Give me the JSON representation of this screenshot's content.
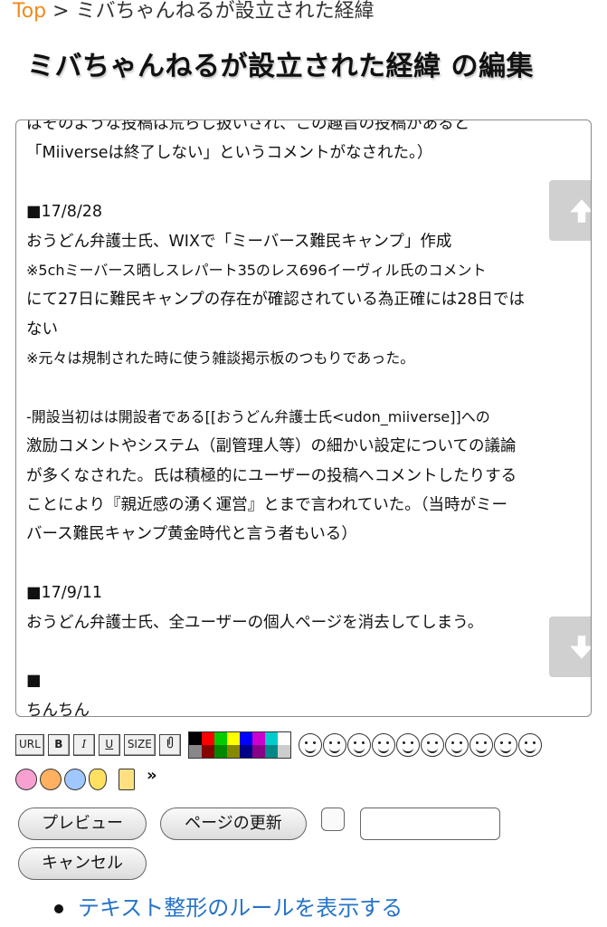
{
  "breadcrumb": {
    "top_label": "Top",
    "separator": ">",
    "current": "ミバちゃんねるが設立された経緯"
  },
  "page_title": "ミバちゃんねるが設立された経緯 の編集",
  "editor": {
    "lines": [
      "はそのような投稿は荒らし扱いされ、この趣旨の投稿があると",
      "「Miiverseは終了しない」というコメントがなされた。）",
      "",
      "■17/8/28",
      "おうどん弁護士氏、WIXで「ミーバース難民キャンプ」作成",
      "※5chミーバース晒しスレパート35のレス696イーヴィル氏のコメント",
      "にて27日に難民キャンプの存在が確認されている為正確には28日では",
      "ない",
      "※元々は規制された時に使う雑談掲示板のつもりであった。",
      "",
      "-開設当初はは開設者である[[おうどん弁護士氏<udon_miiverse]]への",
      "激励コメントやシステム（副管理人等）の細かい設定についての議論",
      "が多くなされた。氏は積極的にユーザーの投稿へコメントしたりする",
      "ことにより『親近感の湧く運営』とまで言われていた。（当時がミー",
      "バース難民キャンプ黄金時代と言う者もいる）",
      "",
      "■17/9/11",
      "おうどん弁護士氏、全ユーザーの個人ページを消去してしまう。",
      "",
      "■",
      "ちんちん"
    ]
  },
  "toolbar": {
    "url_label": "URL",
    "bold_label": "B",
    "italic_label": "I",
    "underline_label": "U",
    "size_label": "SIZE",
    "more_label": "»",
    "palette": [
      "#000000",
      "#ff0000",
      "#00cc00",
      "#ffff00",
      "#0000ff",
      "#cc00cc",
      "#00cccc",
      "#ffffff",
      "#888888",
      "#880000",
      "#008800",
      "#888800",
      "#000088",
      "#880088",
      "#008888",
      "#cccccc"
    ]
  },
  "buttons": {
    "preview_label": "プレビュー",
    "update_label": "ページの更新",
    "cancel_label": "キャンセル"
  },
  "help_link": "テキスト整形のルールを表示する",
  "colors": {
    "accent": "#f08a1c",
    "link": "#2673c8"
  }
}
